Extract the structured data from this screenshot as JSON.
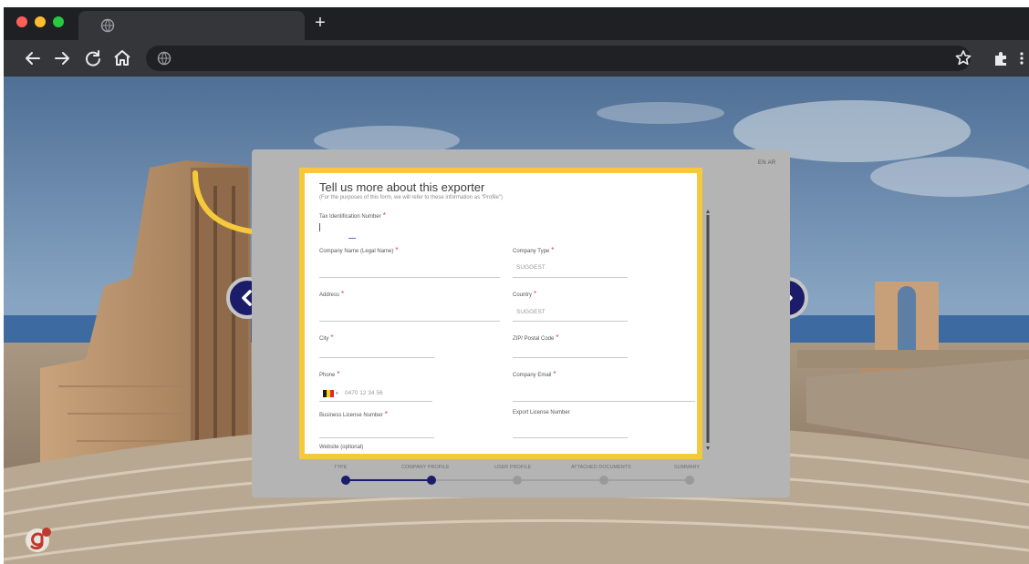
{
  "browser": {
    "new_tab_label": "+",
    "omnibox_url": ""
  },
  "modal": {
    "language_toggle": "EN AR",
    "form": {
      "title": "Tell us more about this exporter",
      "subtitle": "(For the purposes of this form, we will refer to these information as \"Profile\")",
      "fields": {
        "tax_id": {
          "label": "Tax Identification Number",
          "required": "*"
        },
        "company_name": {
          "label": "Company Name (Legal Name)",
          "required": "*"
        },
        "company_type": {
          "label": "Company Type",
          "required": "*",
          "placeholder": "SUGGEST"
        },
        "address": {
          "label": "Address",
          "required": "*"
        },
        "country": {
          "label": "Country",
          "required": "*",
          "placeholder": "SUGGEST"
        },
        "city": {
          "label": "City",
          "required": "*"
        },
        "zip": {
          "label": "ZIP/ Postal Code",
          "required": "*"
        },
        "phone": {
          "label": "Phone",
          "required": "*",
          "placeholder": "0470 12 34 56"
        },
        "company_email": {
          "label": "Company Email",
          "required": "*"
        },
        "business_license": {
          "label": "Business License Number",
          "required": "*"
        },
        "export_license": {
          "label": "Export License Number"
        },
        "website": {
          "label": "Website (optional)"
        }
      }
    },
    "steps": [
      {
        "label": "TYPE",
        "state": "done"
      },
      {
        "label": "COMPANY PROFILE",
        "state": "current"
      },
      {
        "label": "USER PROFILE",
        "state": "todo"
      },
      {
        "label": "ATTACHED DOCUMENTS",
        "state": "todo"
      },
      {
        "label": "SUMMARY",
        "state": "todo"
      }
    ]
  },
  "icons": {
    "back": "arrow-left-icon",
    "forward": "arrow-right-icon",
    "reload": "reload-icon",
    "home": "home-icon",
    "bookmark": "star-icon",
    "extensions": "puzzle-icon",
    "menu": "kebab-menu-icon",
    "prev_slide": "chevron-left-icon",
    "next_slide": "chevron-right-icon",
    "country_flag": "belgium-flag-icon",
    "brand": "g-logo-icon"
  },
  "colors": {
    "highlight": "#f6c93c",
    "accent_navy": "#1c1d6a",
    "required": "#e53935",
    "step_done": "#1c1d6a",
    "step_todo": "#9a9a9a"
  }
}
